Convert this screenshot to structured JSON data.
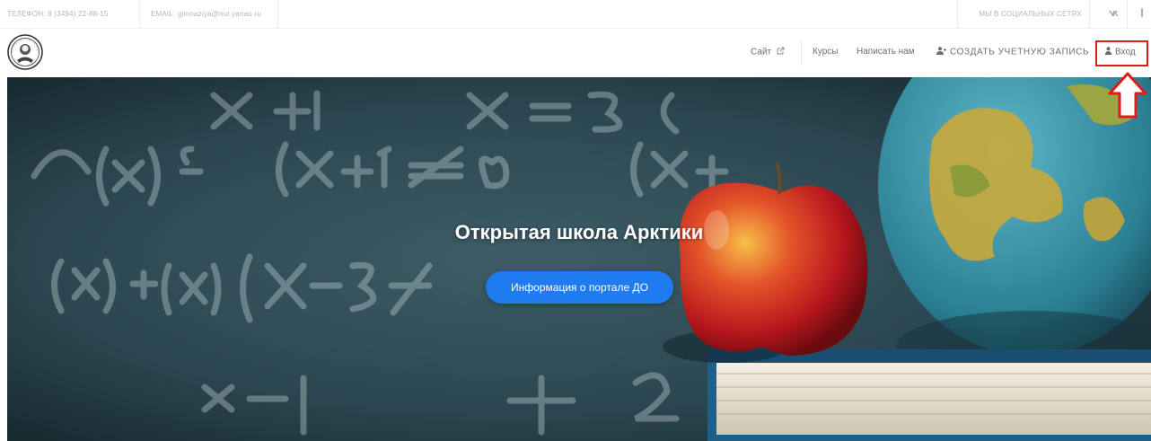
{
  "topbar": {
    "phone": "ТЕЛЕФОН: 8 (3494) 22-88-15",
    "email": "EMAIL: gimnaziya@nur.yanao.ru",
    "social_label": "МЫ В СОЦИАЛЬНЫХ СЕТЯХ",
    "social_icons": [
      "vk-icon",
      "social-icon"
    ]
  },
  "navbar": {
    "site": "Сайт",
    "courses": "Курсы",
    "write": "Написать нам",
    "register": "СОЗДАТЬ УЧЕТНУЮ ЗАПИСЬ",
    "login": "Вход"
  },
  "hero": {
    "title": "Открытая школа Арктики",
    "button": "Информация о портале ДО"
  },
  "colors": {
    "accent": "#1f7bf0",
    "highlight": "#e01b1b",
    "chalkboard": "#26404a"
  }
}
